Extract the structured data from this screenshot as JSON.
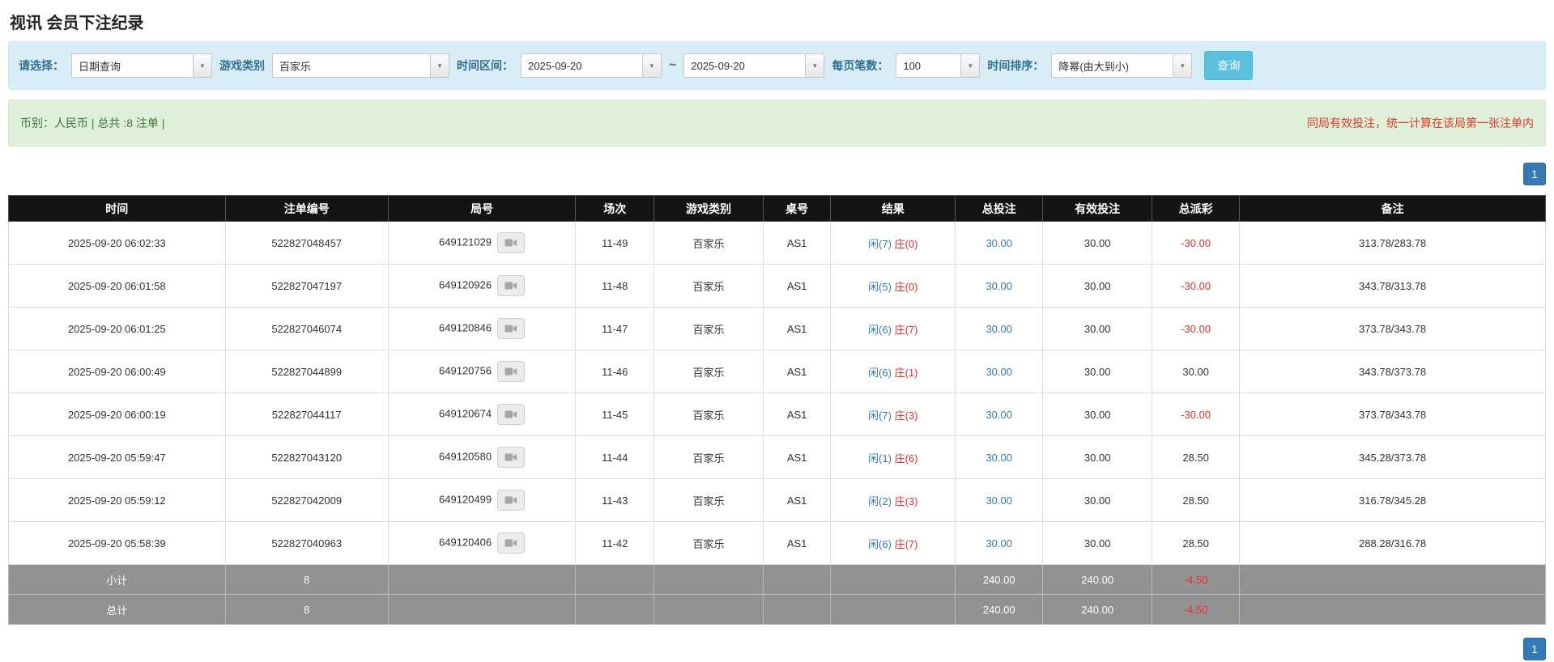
{
  "page_title": "视讯 会员下注纪录",
  "filter": {
    "select_label": "请选择：",
    "select_value": "日期查询",
    "game_type_label": "游戏类别",
    "game_type_value": "百家乐",
    "time_range_label": "时间区间：",
    "date_from": "2025-09-20",
    "range_separator": "~",
    "date_to": "2025-09-20",
    "page_size_label": "每页笔数：",
    "page_size_value": "100",
    "sort_label": "时间排序：",
    "sort_value": "降幂(由大到小)",
    "search_button": "查询"
  },
  "summary": {
    "left_text": "币别：人民币 | 总共 :8 注单 |",
    "right_text": "同局有效投注，统一计算在该局第一张注单内"
  },
  "pagination": {
    "current_page": "1"
  },
  "icons": {
    "dropdown_caret": "▼"
  },
  "table": {
    "headers": [
      "时间",
      "注单编号",
      "局号",
      "场次",
      "游戏类别",
      "桌号",
      "结果",
      "总投注",
      "有效投注",
      "总派彩",
      "备注"
    ],
    "rows": [
      {
        "time": "2025-09-20 06:02:33",
        "bet_id": "522827048457",
        "round_id": "649121029",
        "session": "11-49",
        "game": "百家乐",
        "table_no": "AS1",
        "player": "闲(7)",
        "banker": "庄(0)",
        "total_bet": "30.00",
        "valid_bet": "30.00",
        "payout": "-30.00",
        "note": "313.78/283.78"
      },
      {
        "time": "2025-09-20 06:01:58",
        "bet_id": "522827047197",
        "round_id": "649120926",
        "session": "11-48",
        "game": "百家乐",
        "table_no": "AS1",
        "player": "闲(5)",
        "banker": "庄(0)",
        "total_bet": "30.00",
        "valid_bet": "30.00",
        "payout": "-30.00",
        "note": "343.78/313.78"
      },
      {
        "time": "2025-09-20 06:01:25",
        "bet_id": "522827046074",
        "round_id": "649120846",
        "session": "11-47",
        "game": "百家乐",
        "table_no": "AS1",
        "player": "闲(6)",
        "banker": "庄(7)",
        "total_bet": "30.00",
        "valid_bet": "30.00",
        "payout": "-30.00",
        "note": "373.78/343.78"
      },
      {
        "time": "2025-09-20 06:00:49",
        "bet_id": "522827044899",
        "round_id": "649120756",
        "session": "11-46",
        "game": "百家乐",
        "table_no": "AS1",
        "player": "闲(6)",
        "banker": "庄(1)",
        "total_bet": "30.00",
        "valid_bet": "30.00",
        "payout": "30.00",
        "note": "343.78/373.78"
      },
      {
        "time": "2025-09-20 06:00:19",
        "bet_id": "522827044117",
        "round_id": "649120674",
        "session": "11-45",
        "game": "百家乐",
        "table_no": "AS1",
        "player": "闲(7)",
        "banker": "庄(3)",
        "total_bet": "30.00",
        "valid_bet": "30.00",
        "payout": "-30.00",
        "note": "373.78/343.78"
      },
      {
        "time": "2025-09-20 05:59:47",
        "bet_id": "522827043120",
        "round_id": "649120580",
        "session": "11-44",
        "game": "百家乐",
        "table_no": "AS1",
        "player": "闲(1)",
        "banker": "庄(6)",
        "total_bet": "30.00",
        "valid_bet": "30.00",
        "payout": "28.50",
        "note": "345.28/373.78"
      },
      {
        "time": "2025-09-20 05:59:12",
        "bet_id": "522827042009",
        "round_id": "649120499",
        "session": "11-43",
        "game": "百家乐",
        "table_no": "AS1",
        "player": "闲(2)",
        "banker": "庄(3)",
        "total_bet": "30.00",
        "valid_bet": "30.00",
        "payout": "28.50",
        "note": "316.78/345.28"
      },
      {
        "time": "2025-09-20 05:58:39",
        "bet_id": "522827040963",
        "round_id": "649120406",
        "session": "11-42",
        "game": "百家乐",
        "table_no": "AS1",
        "player": "闲(6)",
        "banker": "庄(7)",
        "total_bet": "30.00",
        "valid_bet": "30.00",
        "payout": "28.50",
        "note": "288.28/316.78"
      }
    ],
    "subtotal": {
      "label": "小计",
      "count": "8",
      "total_bet": "240.00",
      "valid_bet": "240.00",
      "payout": "-4.50"
    },
    "grand_total": {
      "label": "总计",
      "count": "8",
      "total_bet": "240.00",
      "valid_bet": "240.00",
      "payout": "-4.50"
    }
  },
  "colors": {
    "filter_bar_bg": "#d9edf7",
    "filter_label": "#31708f",
    "summary_bar_bg": "#dff0d8",
    "summary_left_text": "#3c763d",
    "summary_right_text": "#e0392b",
    "search_button_bg": "#5bc0de",
    "table_header_bg": "#141414",
    "link_blue": "#337ab7",
    "negative_red": "#dd3030",
    "footer_row_bg": "#929292",
    "pagination_bg": "#337ab7"
  }
}
